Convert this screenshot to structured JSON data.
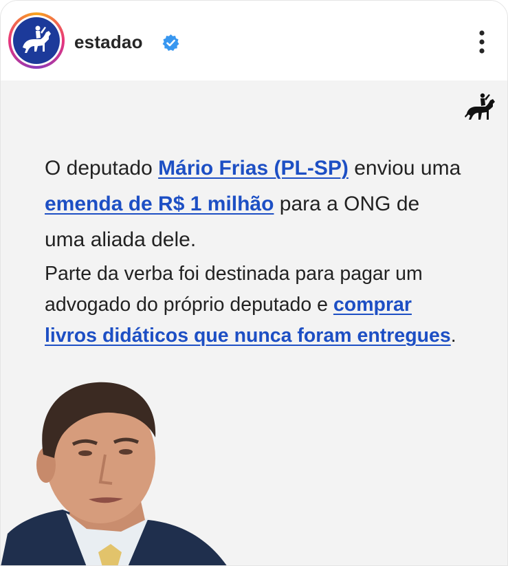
{
  "post": {
    "username": "estadao",
    "verified_icon": "verified-badge-icon",
    "more_icon": "more-options-icon",
    "paragraph1": {
      "t1": "O deputado ",
      "link1": "Mário Frias (PL-SP)",
      "t2": " enviou uma ",
      "link2": "emenda de R$ 1 milhão",
      "t3": " para a ONG de uma aliada dele."
    },
    "paragraph2": {
      "t1": "Parte da verba foi destinada para pagar um advogado do próprio deputado e ",
      "link1": "comprar livros didáticos que nunca foram entregues",
      "t2": "."
    },
    "colors": {
      "link": "#1d4fc4",
      "post_background": "#f3f3f3",
      "avatar_background": "#1c3a9a",
      "verified": "#3897f0"
    }
  }
}
